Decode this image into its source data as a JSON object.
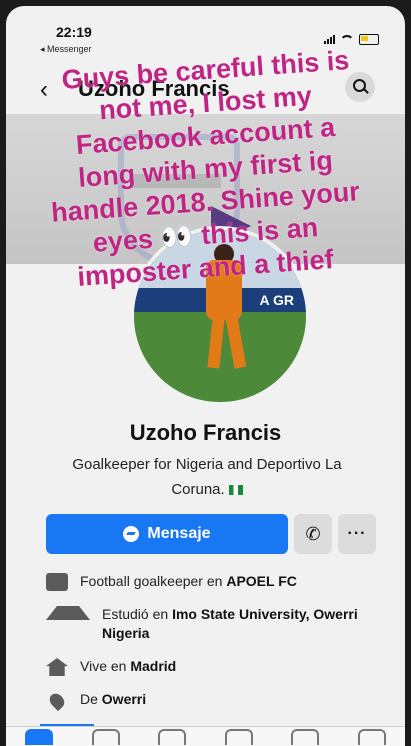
{
  "status_bar": {
    "time": "22:19",
    "back_app": "◂ Messenger"
  },
  "header": {
    "back_icon": "chevron-left-icon",
    "title": "Uzoho Francis",
    "search_icon": "search-icon"
  },
  "overlay_text": {
    "lines": [
      "Guys be careful this is",
      "not me, I lost my",
      "Facebook account a",
      "long with my first ig",
      "handle 2018. Shine your",
      "eyes 👀 this is an",
      "imposter and a thief"
    ]
  },
  "profile": {
    "name": "Uzoho Francis",
    "bio": "Goalkeeper for Nigeria and Deportivo La Coruna.",
    "avatar_board_text": "A GR"
  },
  "actions": {
    "message_label": "Mensaje",
    "call_icon": "phone-icon",
    "more_label": "···"
  },
  "info": {
    "work_prefix": "Football goalkeeper en ",
    "work_place": "APOEL FC",
    "study_prefix": "Estudió en ",
    "study_place": "Imo State University, Owerri Nigeria",
    "lives_prefix": "Vive en ",
    "lives_place": "Madrid",
    "from_prefix": "De ",
    "from_place": "Owerri"
  },
  "colors": {
    "accent": "#1877f2",
    "overlay_text": "#c02586"
  }
}
